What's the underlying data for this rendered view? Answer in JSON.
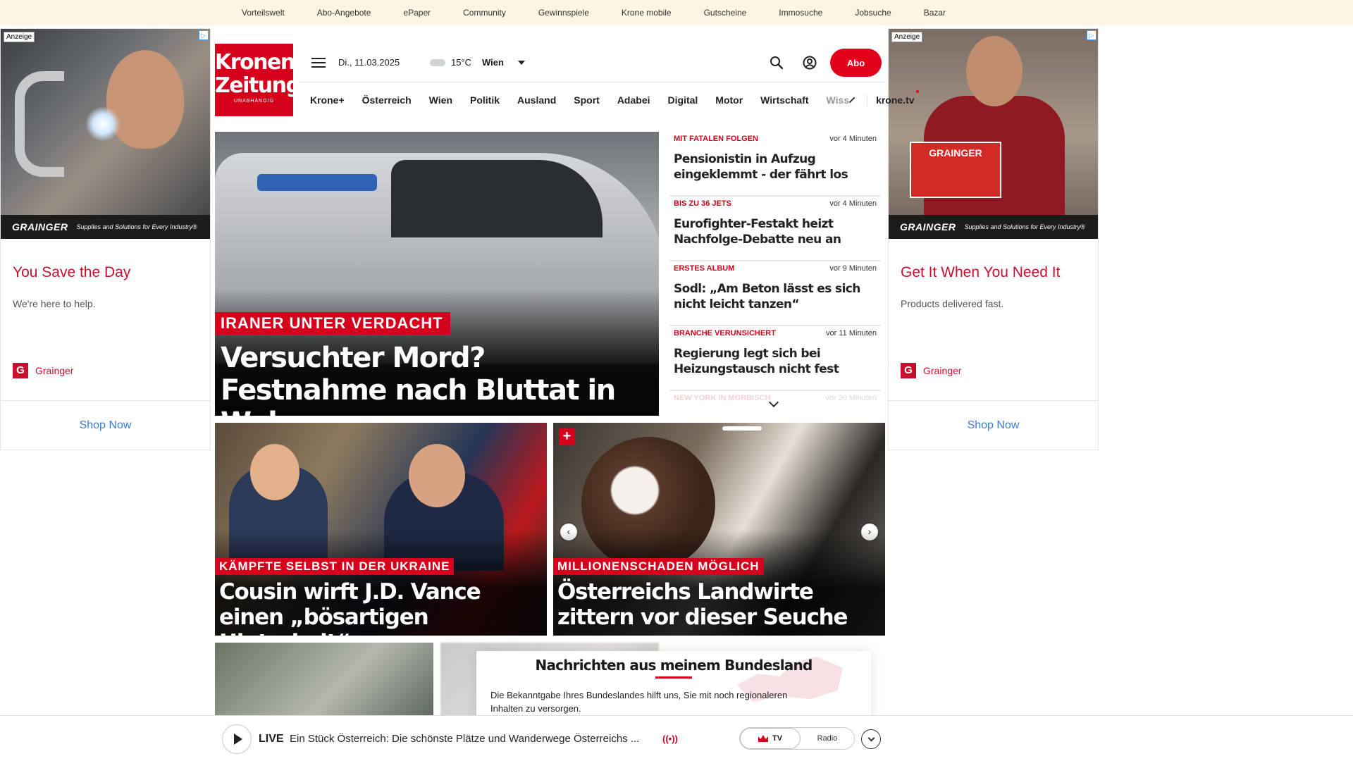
{
  "topbar": {
    "links": [
      "Vorteilswelt",
      "Abo-Angebote",
      "ePaper",
      "Community",
      "Gewinnspiele",
      "Krone mobile",
      "Gutscheine",
      "Immosuche",
      "Jobsuche",
      "Bazar"
    ]
  },
  "ad_left": {
    "label": "Anzeige",
    "brand": "GRAINGER",
    "tagline": "Supplies and Solutions for Every Industry®",
    "headline": "You Save the Day",
    "subtext": "We're here to help.",
    "sponsor": "Grainger",
    "cta": "Shop Now"
  },
  "ad_right": {
    "label": "Anzeige",
    "brand": "GRAINGER",
    "tagline": "Supplies and Solutions for Every Industry®",
    "box_text": "GRAINGER",
    "headline": "Get It When You Need It",
    "subtext": "Products delivered fast.",
    "sponsor": "Grainger",
    "cta": "Shop Now"
  },
  "header": {
    "logo_line1": "Kronen",
    "logo_line2": "Zeitung",
    "logo_line3": "UNABHÄNGIG",
    "date": "Di., 11.03.2025",
    "temperature": "15°C",
    "city": "Wien",
    "abo_label": "Abo"
  },
  "nav": {
    "items": [
      "Krone+",
      "Österreich",
      "Wien",
      "Politik",
      "Ausland",
      "Sport",
      "Adabei",
      "Digital",
      "Motor",
      "Wirtschaft"
    ],
    "faded_item": "Wiss",
    "tv_label": "krone.tv"
  },
  "hero": {
    "kicker": "IRANER UNTER VERDACHT",
    "title": "Versuchter Mord? Festnahme nach Bluttat in Wohnung"
  },
  "ticker": [
    {
      "kicker": "MIT FATALEN FOLGEN",
      "time": "vor 4 Minuten",
      "headline": "Pensionistin in Aufzug eingeklemmt - der fährt los"
    },
    {
      "kicker": "BIS ZU 36 JETS",
      "time": "vor 4 Minuten",
      "headline": "Eurofighter-Festakt heizt Nachfolge-Debatte neu an"
    },
    {
      "kicker": "ERSTES ALBUM",
      "time": "vor 9 Minuten",
      "headline": "Sodl: „Am Beton lässt es sich nicht leicht tanzen“"
    },
    {
      "kicker": "BRANCHE VERUNSICHERT",
      "time": "vor 11 Minuten",
      "headline": "Regierung legt sich bei Heizungstausch nicht fest"
    },
    {
      "kicker": "NEW YORK IN MÖRBISCH",
      "time": "vor 20 Minuten",
      "headline": ""
    }
  ],
  "cards": [
    {
      "kicker": "KÄMPFTE SELBST IN DER UKRAINE",
      "title": "Cousin wirft J.D. Vance einen „bösartigen Hinterhalt“ vor"
    },
    {
      "kicker": "MILLIONENSCHADEN MÖGLICH",
      "title": "Österreichs Landwirte zittern vor dieser Seuche"
    }
  ],
  "modal": {
    "title": "Nachrichten aus meinem Bundesland",
    "text": "Die Bekanntgabe Ihres Bundeslandes hilft uns, Sie mit noch regionaleren Inhalten zu versorgen."
  },
  "player": {
    "live_label": "LIVE",
    "text": "Ein Stück Österreich: Die schönste Plätze und Wanderwege Österreichs ...",
    "tv_label": "TV",
    "radio_label": "Radio"
  },
  "colors": {
    "brand_red": "#d6001c",
    "topbar_bg": "#fdf5e4",
    "ad_link": "#3a7bd5"
  }
}
